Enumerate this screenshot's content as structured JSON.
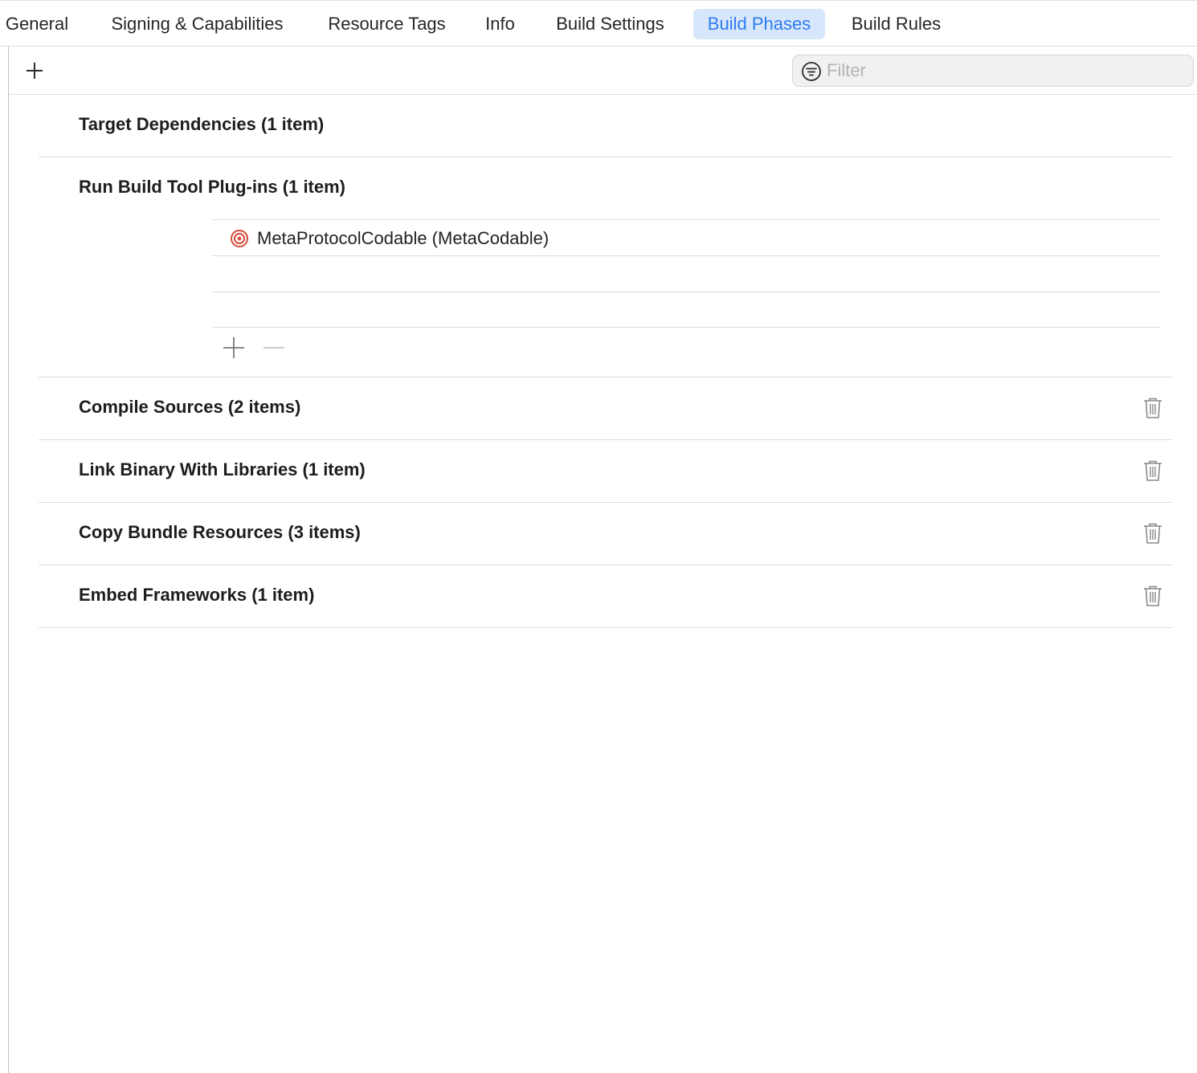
{
  "tabs": [
    {
      "label": "General",
      "active": false
    },
    {
      "label": "Signing & Capabilities",
      "active": false
    },
    {
      "label": "Resource Tags",
      "active": false
    },
    {
      "label": "Info",
      "active": false
    },
    {
      "label": "Build Settings",
      "active": false
    },
    {
      "label": "Build Phases",
      "active": true
    },
    {
      "label": "Build Rules",
      "active": false
    }
  ],
  "toolbar": {
    "add_icon": "plus-icon",
    "filter": {
      "placeholder": "Filter",
      "value": "",
      "icon": "filter-icon"
    }
  },
  "phases": [
    {
      "title": "Target Dependencies (1 item)",
      "deletable": false
    },
    {
      "title": "Run Build Tool Plug-ins (1 item)",
      "deletable": false,
      "items": [
        {
          "label": "MetaProtocolCodable (MetaCodable)",
          "icon": "target-icon"
        }
      ],
      "controls": {
        "add_icon": "plus-icon",
        "remove_icon": "minus-icon"
      }
    },
    {
      "title": "Compile Sources (2 items)",
      "deletable": true
    },
    {
      "title": "Link Binary With Libraries (1 item)",
      "deletable": true
    },
    {
      "title": "Copy Bundle Resources (3 items)",
      "deletable": true
    },
    {
      "title": "Embed Frameworks (1 item)",
      "deletable": true
    }
  ],
  "colors": {
    "accent": "#2f7bf0",
    "active_tab_bg": "#d6e6fb",
    "target_icon": "#d9493a"
  }
}
